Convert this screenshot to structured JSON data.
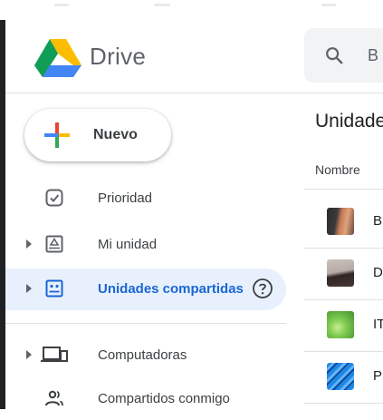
{
  "brand": {
    "name": "Drive"
  },
  "search": {
    "placeholder": "B"
  },
  "new_button": {
    "label": "Nuevo"
  },
  "nav": {
    "items": [
      {
        "label": "Prioridad",
        "icon": "priority-icon"
      },
      {
        "label": "Mi unidad",
        "icon": "my-drive-icon"
      },
      {
        "label": "Unidades compartidas",
        "icon": "shared-drives-icon",
        "active": true
      },
      {
        "label": "Computadoras",
        "icon": "computers-icon"
      },
      {
        "label": "Compartidos conmigo",
        "icon": "shared-with-me-icon"
      }
    ]
  },
  "content": {
    "title": "Unidade",
    "column_header": "Nombre",
    "rows": [
      {
        "name": "B"
      },
      {
        "name": "D"
      },
      {
        "name": "IT"
      },
      {
        "name": "P"
      }
    ]
  },
  "colors": {
    "accent": "#1967d2",
    "active_bg": "#e8f0fe",
    "search_bg": "#f1f3f4",
    "text": "#3c4043"
  }
}
